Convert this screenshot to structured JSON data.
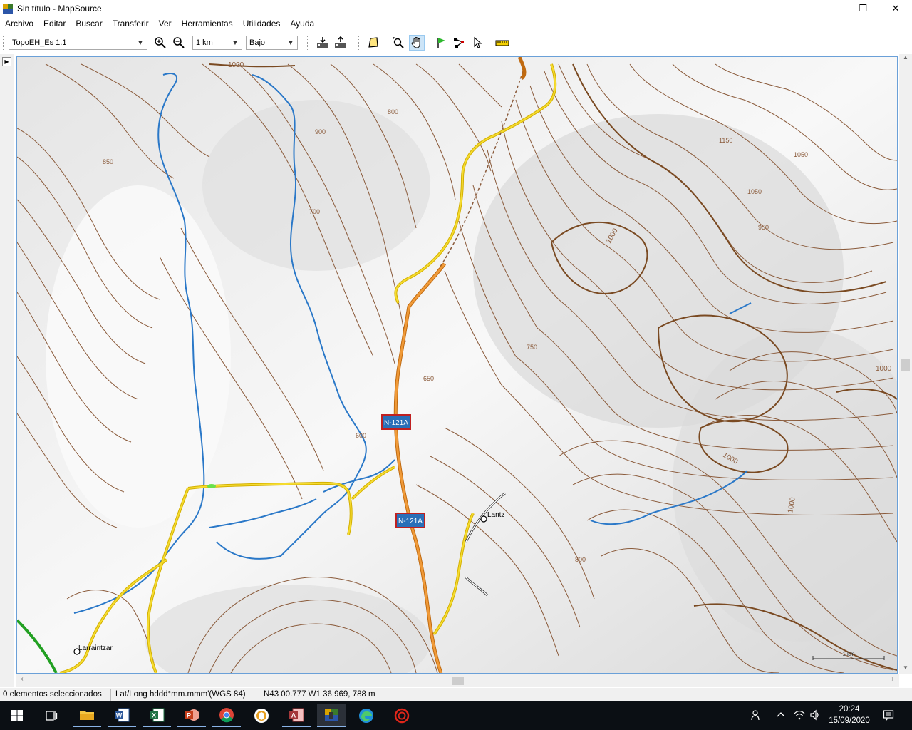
{
  "window": {
    "title": "Sin título - MapSource",
    "minimize": "—",
    "restore": "❐",
    "close": "✕"
  },
  "menu": [
    "Archivo",
    "Editar",
    "Buscar",
    "Transferir",
    "Ver",
    "Herramientas",
    "Utilidades",
    "Ayuda"
  ],
  "toolbar": {
    "map_product": "TopoEH_Es 1.1",
    "zoom_scale": "1 km",
    "detail_level": "Bajo"
  },
  "map": {
    "road_labels": [
      "N-121A",
      "N-121A"
    ],
    "places": [
      "Lantz",
      "Larraintzar"
    ],
    "contour_labels": [
      "1000",
      "900",
      "850",
      "800",
      "750",
      "700",
      "650",
      "600",
      "1000",
      "1050",
      "1150",
      "1050",
      "950",
      "800",
      "1000",
      "1000",
      "1000"
    ],
    "scale_bar": "1 km",
    "colors": {
      "highway": "#e08a2a",
      "road": "#f0d21e",
      "river": "#2a78c8",
      "contour": "#8a5a3a",
      "contour_index": "#7a4a22",
      "trail": "#22a022"
    }
  },
  "statusbar": {
    "selection": "0 elementos seleccionados",
    "format": "Lat/Long hddd°mm.mmm'(WGS 84)",
    "position": "N43 00.777 W1 36.969, 788 m"
  },
  "taskbar": {
    "time": "20:24",
    "date": "15/09/2020",
    "apps": [
      "start-icon",
      "task-view-icon",
      "file-explorer-icon",
      "word-icon",
      "excel-icon",
      "powerpoint-icon",
      "chrome-icon",
      "vpn-icon",
      "access-icon",
      "mapsource-icon",
      "edge-icon",
      "recorder-icon"
    ]
  }
}
